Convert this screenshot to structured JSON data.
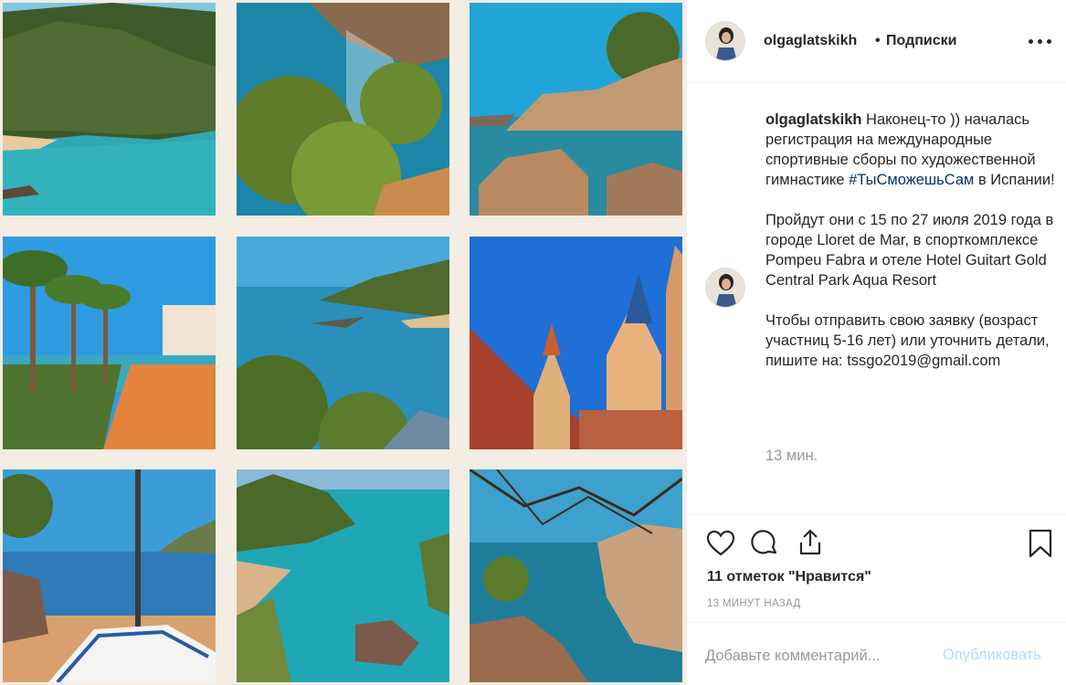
{
  "header": {
    "username": "olgaglatskikh",
    "separator": "•",
    "follow_label": "Подписки",
    "more_icon": "more-horizontal-icon"
  },
  "caption": {
    "username": "olgaglatskikh",
    "text_1": "Наконец-то )) началась регистрация на международные спортивные сборы по художественной гимнастике ",
    "hashtag": "#ТыСможешьСам",
    "text_2": " в Испании!\n\nПройдут они с 15 по 27 июля 2019 года в городе Lloret de Mar, в спорткомплексе Pompeu Fabra и отеле Hotel Guitart Gold Central Park Aqua Resort\n\nЧтобы отправить свою заявку (возраст участниц 5-16 лет) или уточнить детали, пишите на: tssgo2019@gmail.com",
    "time": "13 мин."
  },
  "actions": {
    "like_icon": "heart-icon",
    "comment_icon": "speech-bubble-icon",
    "share_icon": "share-icon",
    "save_icon": "bookmark-icon",
    "likes_text": "11 отметок \"Нравится\"",
    "time_ago": "13 МИНУТ НАЗАД"
  },
  "comment": {
    "placeholder": "Добавьте комментарий...",
    "publish_label": "Опубликовать"
  },
  "media": {
    "tiles": [
      "coastal-cliff-bay",
      "sea-from-pine-forest",
      "rocky-shore-with-pine",
      "palm-promenade",
      "bay-view-with-trees",
      "modernist-church-towers",
      "boat-on-beach",
      "turquoise-cove",
      "cove-through-branches"
    ]
  },
  "colors": {
    "link": "#003569",
    "publish_disabled": "#b3dbff",
    "muted": "#999999",
    "photo_background": "#f4ede3"
  }
}
